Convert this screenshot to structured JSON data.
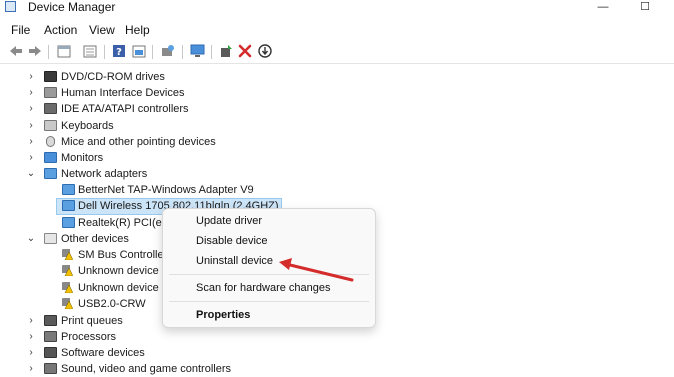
{
  "window": {
    "title": "Device Manager",
    "minimize_glyph": "—",
    "maximize_glyph": "☐"
  },
  "menu": {
    "file": "File",
    "action": "Action",
    "view": "View",
    "help": "Help"
  },
  "toolbar": {
    "icons": [
      "back-arrow-icon",
      "forward-arrow-icon",
      "show-hide-icon",
      "properties-icon",
      "help-icon",
      "action-icon",
      "scan-icon",
      "monitor-icon",
      "update-driver-icon",
      "uninstall-icon",
      "disable-icon"
    ],
    "uninstall_color": "#d42b2b"
  },
  "tree": {
    "dvd": "DVD/CD-ROM drives",
    "hid": "Human Interface Devices",
    "ide": "IDE ATA/ATAPI controllers",
    "keyboards": "Keyboards",
    "mice": "Mice and other pointing devices",
    "monitors": "Monitors",
    "network": "Network adapters",
    "betternet": "BetterNet TAP-Windows Adapter V9",
    "dell": "Dell Wireless 1705 802.11b|g|n (2.4GHZ)",
    "realtek": "Realtek(R) PCI(e)",
    "other": "Other devices",
    "smbus": "SM Bus Controlle",
    "unknown1": "Unknown device",
    "unknown2": "Unknown device",
    "usb": "USB2.0-CRW",
    "print": "Print queues",
    "processors": "Processors",
    "software": "Software devices",
    "sound": "Sound, video and game controllers",
    "collapsed_chevron": "›",
    "expanded_chevron": "⌄"
  },
  "context_menu": {
    "update": "Update driver",
    "disable": "Disable device",
    "uninstall": "Uninstall device",
    "scan": "Scan for hardware changes",
    "properties": "Properties"
  },
  "colors": {
    "selection": "#cce4f7",
    "annotation_arrow": "#d42b2b",
    "warning": "#f2c200"
  }
}
